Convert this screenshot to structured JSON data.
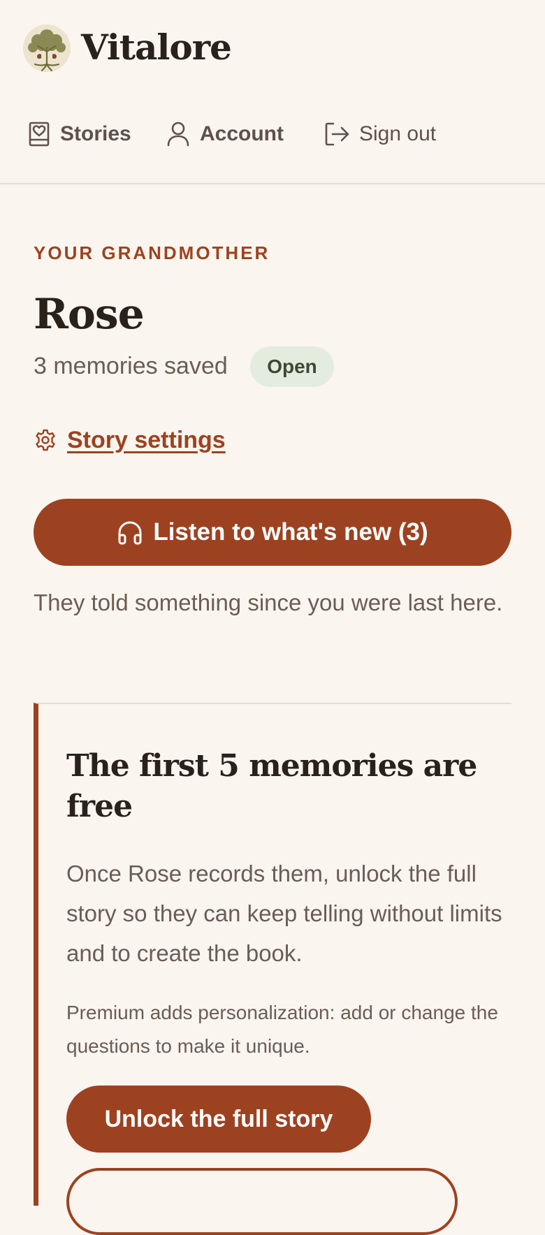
{
  "app": {
    "brand": "Vitalore",
    "logo_icon": "tree-logo-icon"
  },
  "nav": {
    "stories_label": "Stories",
    "account_label": "Account",
    "signout_label": "Sign out"
  },
  "story": {
    "relation": "YOUR GRANDMOTHER",
    "name": "Rose",
    "memories_count": "3 memories saved",
    "status": "Open",
    "settings_label": "Story settings"
  },
  "listen": {
    "button_label": "Listen to what's new (3)",
    "hint": "They told something since you were last here."
  },
  "promo": {
    "title": "The first 5 memories are free",
    "body": "Once Rose records them, unlock the full story so they can keep telling without limits and to create the book.",
    "note": "Premium adds personalization: add or change the questions to make it unique.",
    "unlock_label": "Unlock the full story"
  },
  "colors": {
    "accent": "#9c4221",
    "background": "#faf5ef",
    "text": "#2a211b",
    "muted": "#6b5d54",
    "badge_bg": "#e4ece0",
    "badge_text": "#3c4a34"
  }
}
